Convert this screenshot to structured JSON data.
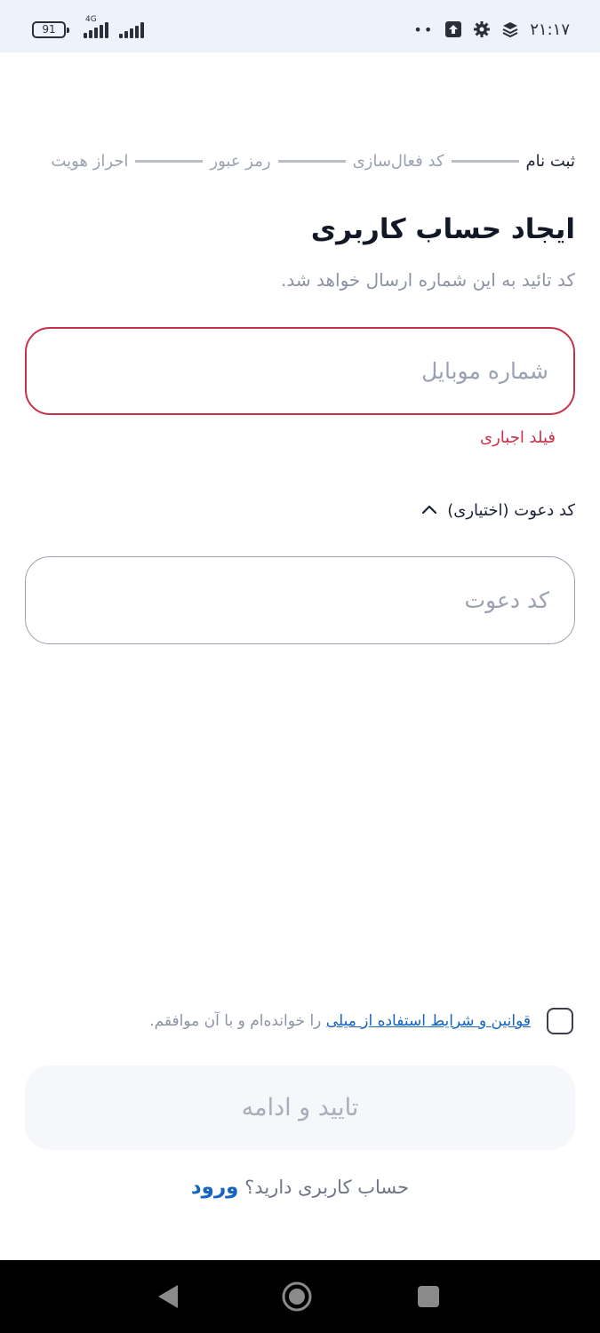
{
  "status_bar": {
    "time": "۲۱:۱۷",
    "dots": "••",
    "battery": "91",
    "network": "4G",
    "icons": [
      "upload-icon",
      "gear-icon",
      "layers-icon"
    ]
  },
  "stepper": {
    "steps": [
      {
        "label": "ثبت نام",
        "active": true
      },
      {
        "label": "کد فعال‌سازی",
        "active": false
      },
      {
        "label": "رمز عبور",
        "active": false
      },
      {
        "label": "احراز هویت",
        "active": false
      }
    ]
  },
  "page": {
    "title": "ایجاد حساب کاربری",
    "subtitle": "کد تائید به این شماره ارسال خواهد شد."
  },
  "mobile_field": {
    "placeholder": "شماره موبایل",
    "value": "",
    "error": "فیلد اجباری"
  },
  "invite": {
    "toggle_label": "کد دعوت (اختیاری)",
    "placeholder": "کد دعوت",
    "value": ""
  },
  "terms": {
    "link_text": "قوانین و شرایط استفاده از میلی",
    "suffix": " را خوانده‌ام و با آن موافقم.",
    "checked": false
  },
  "actions": {
    "continue_label": "تایید و ادامه",
    "have_account": "حساب کاربری دارید؟ ",
    "login_label": "ورود"
  },
  "colors": {
    "error": "#c8314a",
    "link": "#1565c0",
    "status_bar_bg": "#eef2fb"
  }
}
